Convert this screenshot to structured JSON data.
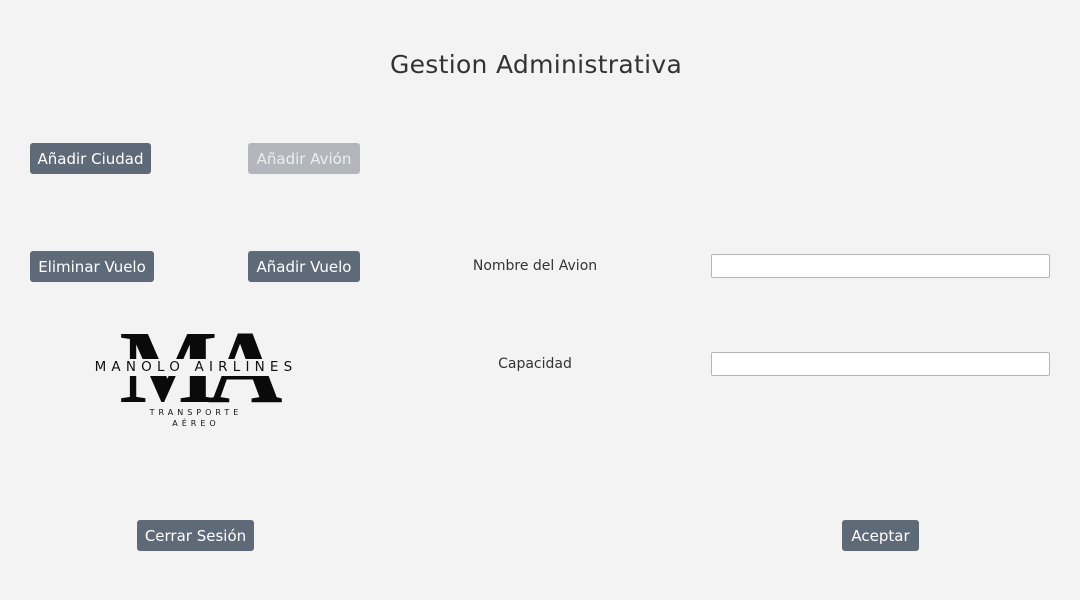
{
  "header": {
    "title": "Gestion Administrativa"
  },
  "actions": {
    "add_city": "Añadir Ciudad",
    "add_plane": "Añadir Avión",
    "delete_flight": "Eliminar Vuelo",
    "add_flight": "Añadir Vuelo",
    "logout": "Cerrar Sesión",
    "accept": "Aceptar"
  },
  "form": {
    "plane_name_label": "Nombre del Avion",
    "plane_name_value": "",
    "capacity_label": "Capacidad",
    "capacity_value": ""
  },
  "logo": {
    "monogram": "MA",
    "name": "MANOLO AIRLINES",
    "subtitle_line1": "TRANSPORTE",
    "subtitle_line2": "AÉREO"
  },
  "colors": {
    "background": "#f3f3f3",
    "button": "#5f6a78",
    "button_disabled": "#b3b7bc",
    "text": "#333333"
  }
}
